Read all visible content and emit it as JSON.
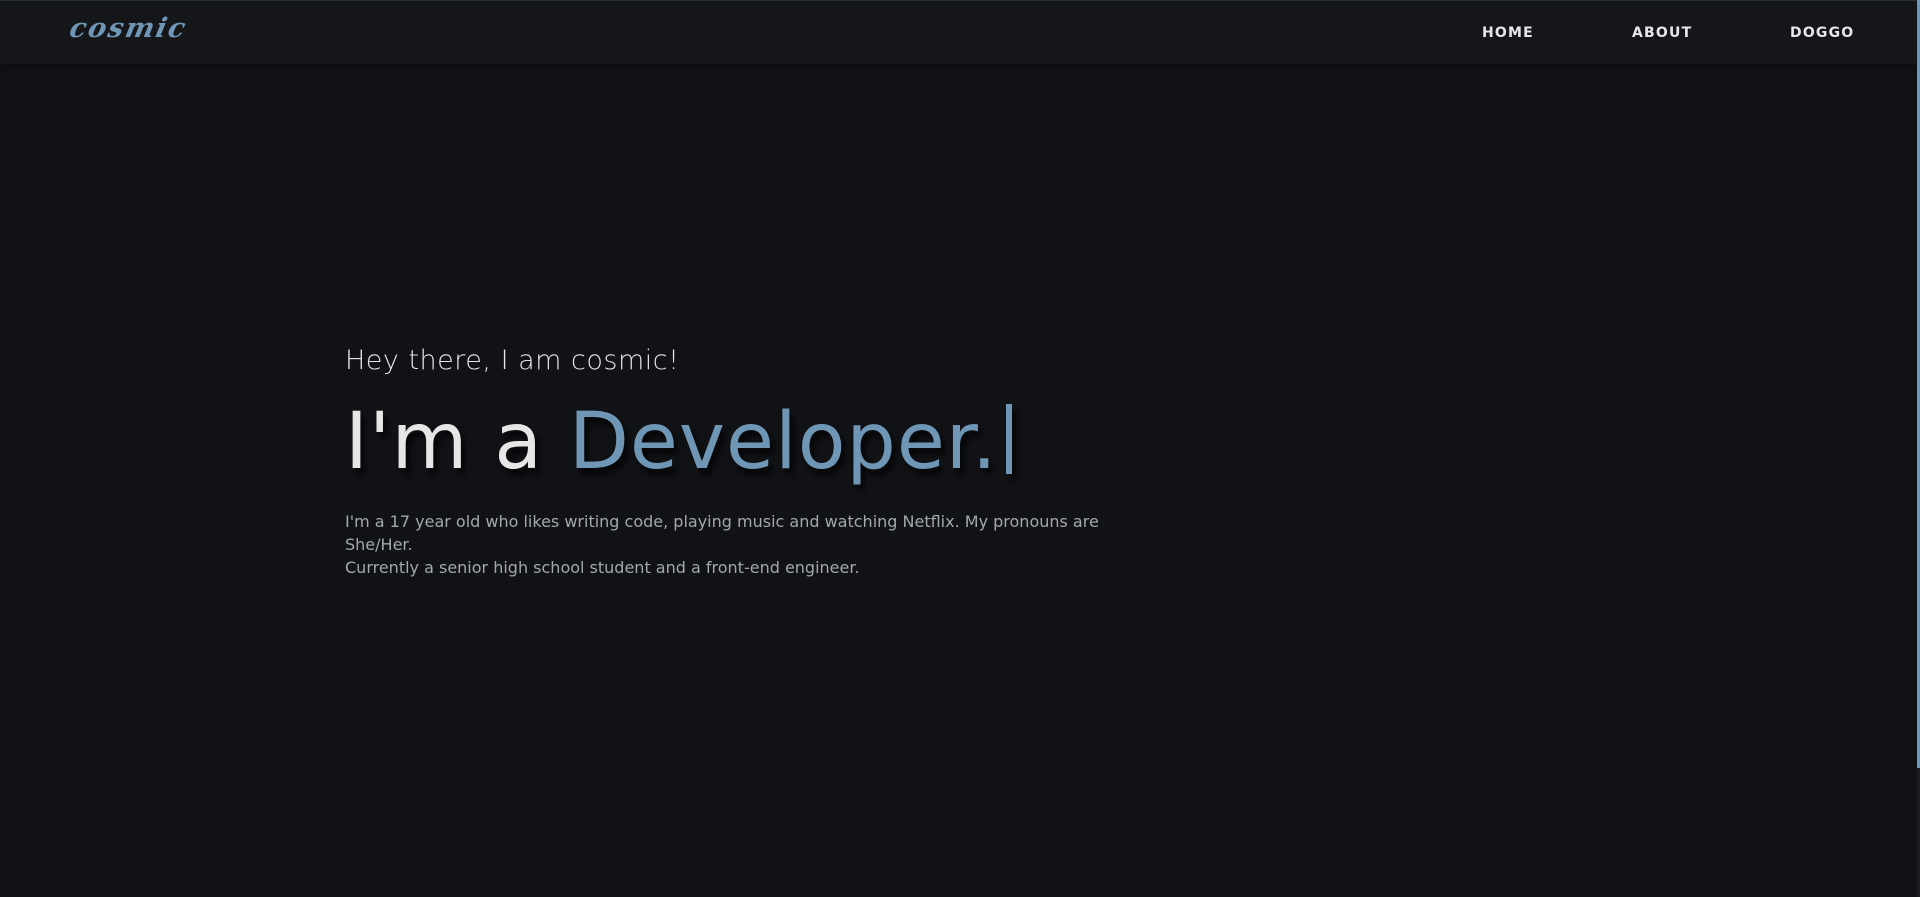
{
  "navbar": {
    "logo": "cosmic",
    "links": [
      "HOME",
      "ABOUT",
      "DOGGO"
    ]
  },
  "hero": {
    "greeting": "Hey there, I am cosmic!",
    "headline_prefix": "I'm a",
    "headline_role": "Developer.",
    "bio_line1": "I'm a 17 year old who likes writing code, playing music and watching Netflix. My pronouns are She/Her.",
    "bio_line2": "Currently a senior high school student and a front-end engineer."
  },
  "colors": {
    "background": "#111216",
    "navbar": "#14161a",
    "accent": "#6f97b5",
    "text": "#e6e6e6",
    "muted_text": "#a3a7ad"
  }
}
